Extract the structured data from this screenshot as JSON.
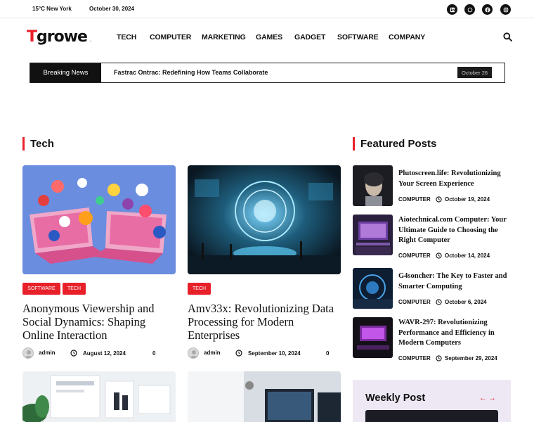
{
  "topbar": {
    "weather": "15°C New York",
    "date": "October 30, 2024",
    "social": [
      "linkedin-icon",
      "whatsapp-icon",
      "facebook-icon",
      "instagram-icon"
    ]
  },
  "logo": {
    "first_letter": "T",
    "rest": "growe",
    "dot": "."
  },
  "nav": [
    "TECH",
    "COMPUTER",
    "MARKETING",
    "GAMES",
    "GADGET",
    "SOFTWARE",
    "COMPANY"
  ],
  "breaking": {
    "label": "Breaking News",
    "headline": "Fastrac Ontrac: Redefining How Teams Collaborate",
    "date": "October 26"
  },
  "tech": {
    "title": "Tech",
    "cards": [
      {
        "tags": [
          "SOFTWARE",
          "TECH"
        ],
        "title": "Anonymous Viewership and Social Dynamics: Shaping Online Interaction",
        "author": "admin",
        "date": "August 12, 2024",
        "comments": "0"
      },
      {
        "tags": [
          "TECH"
        ],
        "title": "Amv33x: Revolutionizing Data Processing for Modern Enterprises",
        "author": "admin",
        "date": "September 10, 2024",
        "comments": "0"
      }
    ]
  },
  "featured": {
    "title": "Featured Posts",
    "posts": [
      {
        "title": "Plutoscreen.life: Revolutionizing Your Screen Experience",
        "category": "COMPUTER",
        "date": "October 19, 2024"
      },
      {
        "title": "Aiotechnical.com Computer: Your Ultimate Guide to Choosing the Right Computer",
        "category": "COMPUTER",
        "date": "October 14, 2024"
      },
      {
        "title": "G4soncher: The Key to Faster and Smarter Computing",
        "category": "COMPUTER",
        "date": "October 6, 2024"
      },
      {
        "title": "WAVR-297: Revolutionizing Performance and Efficiency in Modern Computers",
        "category": "COMPUTER",
        "date": "September 29, 2024"
      }
    ]
  },
  "weekly": {
    "title": "Weekly Post",
    "prev": "←",
    "next": "→"
  },
  "colors": {
    "accent": "#e8202a",
    "dark": "#111111",
    "weekly_bg": "#ede8f3"
  }
}
